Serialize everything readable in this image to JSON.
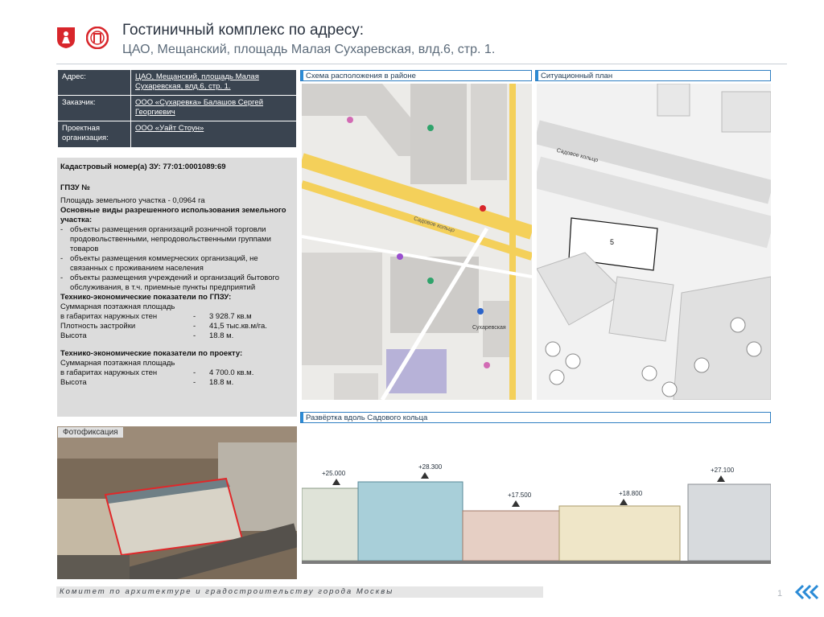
{
  "header": {
    "title_line1": "Гостиничный комплекс по адресу:",
    "title_line2": "ЦАО, Мещанский, площадь Малая Сухаревская, влд.6, стр. 1."
  },
  "info": {
    "rows": [
      {
        "key": "Адрес:",
        "value": "ЦАО, Мещанский, площадь Малая Сухаревская, влд.6, стр. 1."
      },
      {
        "key": "Заказчик:",
        "value": "ООО «Сухаревка» Балашов Сергей Георгиевич"
      },
      {
        "key": "Проектная организация:",
        "value": "ООО «Уайт Стоун»"
      }
    ]
  },
  "params": {
    "cadastral": "Кадастровый номер(а) ЗУ: 77:01:0001089:69",
    "gpzu": "ГПЗУ №",
    "area": "Площадь земельного участка - 0,0964 га",
    "use_title": "Основные виды разрешенного использования земельного участка:",
    "uses": [
      "объекты размещения организаций розничной торговли продовольственными, непродовольственными группами товаров",
      "объекты размещения коммерческих организаций, не связанных с проживанием населения",
      "объекты размещения учреждений и организаций бытового обслуживания, в т.ч. приемные пункты предприятий"
    ],
    "gpzu_title": "Технико-экономические показатели по ГПЗУ:",
    "gpzu_sum_label": "Суммарная поэтажная площадь",
    "gpzu_rows": [
      {
        "label": "в габаритах наружных стен",
        "dash": "-",
        "value": "3 928.7 кв.м"
      },
      {
        "label": "Плотность застройки",
        "dash": "-",
        "value": "41,5 тыс.кв.м/га."
      },
      {
        "label": "Высота",
        "dash": "-",
        "value": "18.8 м."
      }
    ],
    "project_title": "Технико-экономические показатели по проекту:",
    "project_sum_label": "Суммарная поэтажная площадь",
    "project_rows": [
      {
        "label": "в габаритах наружных стен",
        "dash": "-",
        "value": "4 700.0 кв.м."
      },
      {
        "label": "Высота",
        "dash": "-",
        "value": "18.8 м."
      }
    ]
  },
  "panels": {
    "location_scheme": "Схема расположения в районе",
    "situation_plan": "Ситуационный план",
    "photo": "Фотофиксация",
    "elevation": "Развёртка вдоль Садового кольца"
  },
  "map": {
    "street_label": "Садовое кольцо",
    "metro_label": "Сухаревская",
    "plot_number": "5"
  },
  "elevation_marks": [
    "+25.000",
    "+28.300",
    "+17.500",
    "+18.800",
    "+27.100"
  ],
  "footer": {
    "text": "Комитет по архитектуре и градостроительству города Москвы",
    "page": "1"
  },
  "colors": {
    "accent": "#2b8bd6",
    "table_bg": "#3a4450",
    "params_bg": "#dcdcdc",
    "photo_highlight": "#e0282a"
  }
}
